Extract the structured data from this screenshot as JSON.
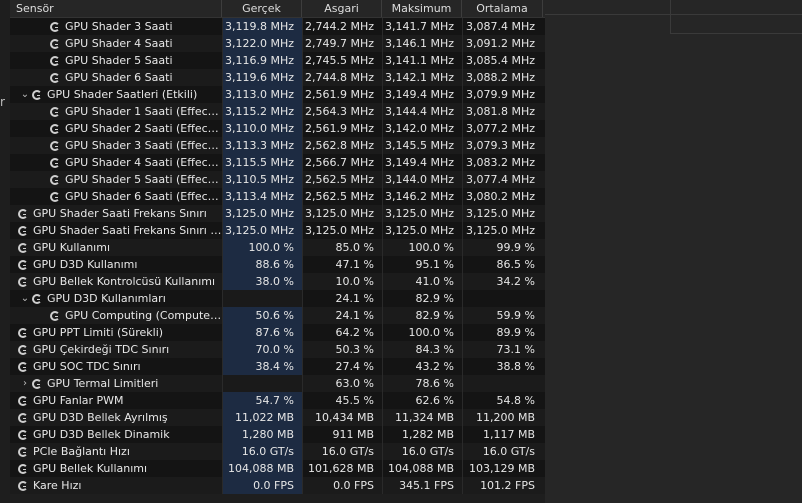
{
  "columns": [
    "Sensör",
    "Gerçek",
    "Asgari",
    "Maksimum",
    "Ortalama"
  ],
  "left_edge_glyph": "r",
  "rows": [
    {
      "label": "GPU Shader 3 Saati",
      "indent": 2,
      "chev": "",
      "cur": "3,119.8 MHz",
      "min": "2,744.2 MHz",
      "max": "3,141.7 MHz",
      "avg": "3,087.4 MHz"
    },
    {
      "label": "GPU Shader 4 Saati",
      "indent": 2,
      "chev": "",
      "cur": "3,122.0 MHz",
      "min": "2,749.7 MHz",
      "max": "3,146.1 MHz",
      "avg": "3,091.2 MHz"
    },
    {
      "label": "GPU Shader 5 Saati",
      "indent": 2,
      "chev": "",
      "cur": "3,116.9 MHz",
      "min": "2,745.5 MHz",
      "max": "3,141.1 MHz",
      "avg": "3,085.4 MHz"
    },
    {
      "label": "GPU Shader 6 Saati",
      "indent": 2,
      "chev": "",
      "cur": "3,119.6 MHz",
      "min": "2,744.8 MHz",
      "max": "3,142.1 MHz",
      "avg": "3,088.2 MHz"
    },
    {
      "label": "GPU Shader Saatleri (Etkili)",
      "indent": 1,
      "chev": "⌄",
      "cur": "3,113.0 MHz",
      "min": "2,561.9 MHz",
      "max": "3,149.4 MHz",
      "avg": "3,079.9 MHz"
    },
    {
      "label": "GPU Shader 1 Saati (Effective)",
      "indent": 2,
      "chev": "",
      "cur": "3,115.2 MHz",
      "min": "2,564.3 MHz",
      "max": "3,144.4 MHz",
      "avg": "3,081.8 MHz"
    },
    {
      "label": "GPU Shader 2 Saati (Effective)",
      "indent": 2,
      "chev": "",
      "cur": "3,110.0 MHz",
      "min": "2,561.9 MHz",
      "max": "3,142.0 MHz",
      "avg": "3,077.2 MHz"
    },
    {
      "label": "GPU Shader 3 Saati (Effective)",
      "indent": 2,
      "chev": "",
      "cur": "3,113.3 MHz",
      "min": "2,562.8 MHz",
      "max": "3,145.5 MHz",
      "avg": "3,079.3 MHz"
    },
    {
      "label": "GPU Shader 4 Saati (Effective)",
      "indent": 2,
      "chev": "",
      "cur": "3,115.5 MHz",
      "min": "2,566.7 MHz",
      "max": "3,149.4 MHz",
      "avg": "3,083.2 MHz"
    },
    {
      "label": "GPU Shader 5 Saati (Effective)",
      "indent": 2,
      "chev": "",
      "cur": "3,110.5 MHz",
      "min": "2,562.5 MHz",
      "max": "3,144.0 MHz",
      "avg": "3,077.4 MHz"
    },
    {
      "label": "GPU Shader 6 Saati (Effective)",
      "indent": 2,
      "chev": "",
      "cur": "3,113.4 MHz",
      "min": "2,562.5 MHz",
      "max": "3,146.2 MHz",
      "avg": "3,080.2 MHz"
    },
    {
      "label": "GPU Shader Saati Frekans Sınırı",
      "indent": 0,
      "chev": "",
      "cur": "3,125.0 MHz",
      "min": "3,125.0 MHz",
      "max": "3,125.0 MHz",
      "avg": "3,125.0 MHz"
    },
    {
      "label": "GPU Shader Saati Frekans Sınırı (...",
      "indent": 0,
      "chev": "",
      "cur": "3,125.0 MHz",
      "min": "3,125.0 MHz",
      "max": "3,125.0 MHz",
      "avg": "3,125.0 MHz"
    },
    {
      "label": "GPU Kullanımı",
      "indent": 0,
      "chev": "",
      "cur": "100.0 %",
      "min": "85.0 %",
      "max": "100.0 %",
      "avg": "99.9 %"
    },
    {
      "label": "GPU D3D Kullanımı",
      "indent": 0,
      "chev": "",
      "cur": "88.6 %",
      "min": "47.1 %",
      "max": "95.1 %",
      "avg": "86.5 %"
    },
    {
      "label": "GPU Bellek Kontrolcüsü Kullanımı",
      "indent": 0,
      "chev": "",
      "cur": "38.0 %",
      "min": "10.0 %",
      "max": "41.0 %",
      "avg": "34.2 %"
    },
    {
      "label": "GPU D3D Kullanımları",
      "indent": 1,
      "chev": "⌄",
      "cur": "",
      "min": "24.1 %",
      "max": "82.9 %",
      "avg": ""
    },
    {
      "label": "GPU Computing (Compute 0) ...",
      "indent": 2,
      "chev": "",
      "cur": "50.6 %",
      "min": "24.1 %",
      "max": "82.9 %",
      "avg": "59.9 %"
    },
    {
      "label": "GPU PPT Limiti (Sürekli)",
      "indent": 0,
      "chev": "",
      "cur": "87.6 %",
      "min": "64.2 %",
      "max": "100.0 %",
      "avg": "89.9 %"
    },
    {
      "label": "GPU Çekirdeği TDC Sınırı",
      "indent": 0,
      "chev": "",
      "cur": "70.0 %",
      "min": "50.3 %",
      "max": "84.3 %",
      "avg": "73.1 %"
    },
    {
      "label": "GPU SOC TDC Sınırı",
      "indent": 0,
      "chev": "",
      "cur": "38.4 %",
      "min": "27.4 %",
      "max": "43.2 %",
      "avg": "38.8 %"
    },
    {
      "label": "GPU Termal Limitleri",
      "indent": 1,
      "chev": "›",
      "cur": "",
      "min": "63.0 %",
      "max": "78.6 %",
      "avg": ""
    },
    {
      "label": "GPU Fanlar PWM",
      "indent": 0,
      "chev": "",
      "cur": "54.7 %",
      "min": "45.5 %",
      "max": "62.6 %",
      "avg": "54.8 %"
    },
    {
      "label": "GPU D3D Bellek Ayrılmış",
      "indent": 0,
      "chev": "",
      "cur": "11,022 MB",
      "min": "10,434 MB",
      "max": "11,324 MB",
      "avg": "11,200 MB"
    },
    {
      "label": "GPU D3D Bellek Dinamik",
      "indent": 0,
      "chev": "",
      "cur": "1,280 MB",
      "min": "911 MB",
      "max": "1,282 MB",
      "avg": "1,117 MB"
    },
    {
      "label": "PCIe Bağlantı Hızı",
      "indent": 0,
      "chev": "",
      "cur": "16.0 GT/s",
      "min": "16.0 GT/s",
      "max": "16.0 GT/s",
      "avg": "16.0 GT/s"
    },
    {
      "label": "GPU Bellek Kullanımı",
      "indent": 0,
      "chev": "",
      "cur": "104,088 MB",
      "min": "101,628 MB",
      "max": "104,088 MB",
      "avg": "103,129 MB"
    },
    {
      "label": "Kare Hızı",
      "indent": 0,
      "chev": "",
      "cur": "0.0 FPS",
      "min": "0.0 FPS",
      "max": "345.1 FPS",
      "avg": "101.2 FPS"
    }
  ]
}
